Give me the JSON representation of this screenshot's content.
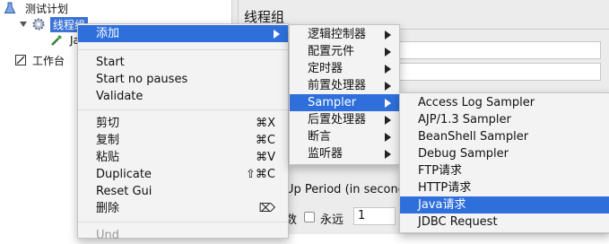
{
  "tree": {
    "test_plan": "测试计划",
    "thread_group": "线程组",
    "child_partial": "Ja",
    "workbench": "工作台"
  },
  "panel": {
    "title": "线程组",
    "ramp_up_label": "Up Period (in second",
    "loop_count_label_partial": "数",
    "forever_label": "永远",
    "loop_count_value": "1"
  },
  "context_menu": {
    "add": "添加",
    "start": "Start",
    "start_no_pauses": "Start no pauses",
    "validate": "Validate",
    "cut": "剪切",
    "cut_shortcut": "⌘X",
    "copy": "复制",
    "copy_shortcut": "⌘C",
    "paste": "粘贴",
    "paste_shortcut": "⌘V",
    "duplicate": "Duplicate",
    "duplicate_shortcut": "⇧⌘C",
    "reset_gui": "Reset Gui",
    "delete": "删除",
    "delete_shortcut": "⌦",
    "partial_next": "Und"
  },
  "add_submenu": {
    "logic_controller": "逻辑控制器",
    "config_element": "配置元件",
    "timer": "定时器",
    "pre_processor": "前置处理器",
    "sampler": "Sampler",
    "post_processor": "后置处理器",
    "assertion": "断言",
    "listener": "监听器"
  },
  "sampler_submenu": {
    "access_log": "Access Log Sampler",
    "ajp": "AJP/1.3 Sampler",
    "beanshell": "BeanShell Sampler",
    "debug": "Debug Sampler",
    "ftp": "FTP请求",
    "http": "HTTP请求",
    "java": "Java请求",
    "jdbc": "JDBC Request"
  },
  "colors": {
    "highlight": "#2f6fdc",
    "menu_bg": "#f3f3f3"
  }
}
